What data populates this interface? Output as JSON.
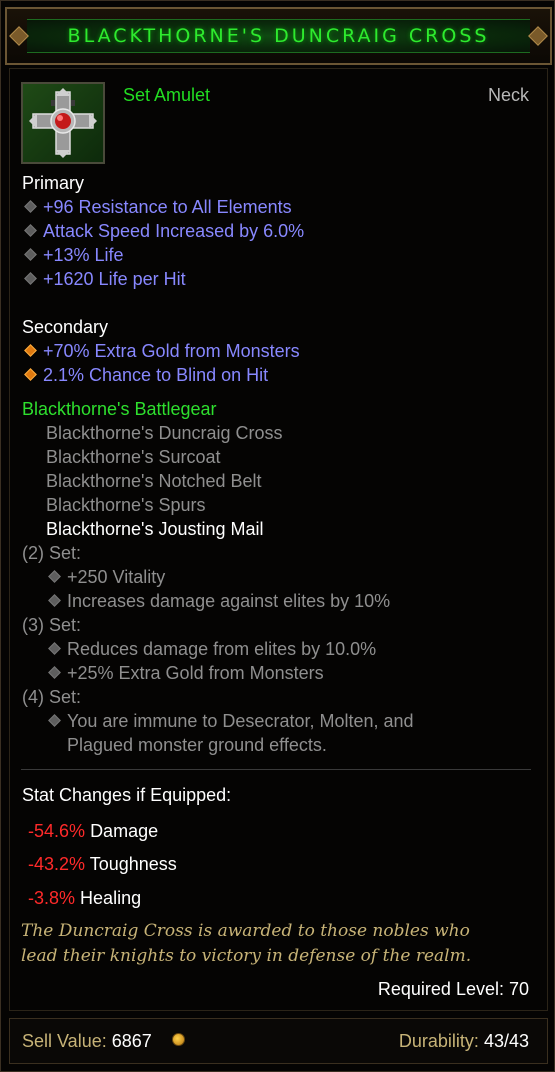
{
  "item": {
    "name": "BLACKTHORNE'S DUNCRAIG CROSS",
    "type": "Set Amulet",
    "slot": "Neck"
  },
  "primary": {
    "heading": "Primary",
    "stats": [
      "+96 Resistance to All Elements",
      "Attack Speed Increased by 6.0%",
      "+13% Life",
      "+1620 Life per Hit"
    ]
  },
  "secondary": {
    "heading": "Secondary",
    "stats": [
      "+70% Extra Gold from Monsters",
      "2.1% Chance to Blind on Hit"
    ]
  },
  "set": {
    "name": "Blackthorne's Battlegear",
    "pieces": [
      "Blackthorne's Duncraig Cross",
      "Blackthorne's Surcoat",
      "Blackthorne's Notched Belt",
      "Blackthorne's Spurs",
      "Blackthorne's Jousting Mail"
    ],
    "bonuses": [
      {
        "label": "(2) Set:",
        "effects": [
          "+250 Vitality",
          "Increases damage against elites by 10%"
        ]
      },
      {
        "label": "(3) Set:",
        "effects": [
          "Reduces damage from elites by 10.0%",
          "+25% Extra Gold from Monsters"
        ]
      },
      {
        "label": "(4) Set:",
        "effects": [
          "You are immune to Desecrator, Molten, and",
          "Plagued monster ground effects."
        ]
      }
    ]
  },
  "stat_changes": {
    "heading": "Stat Changes if Equipped:",
    "rows": [
      {
        "value": "-54.6%",
        "label": "Damage"
      },
      {
        "value": "-43.2%",
        "label": "Toughness"
      },
      {
        "value": "-3.8%",
        "label": "Healing"
      }
    ]
  },
  "flavor": {
    "line1": "The Duncraig Cross is awarded to those nobles who",
    "line2": "lead their knights to victory in defense of the realm."
  },
  "required_level": "Required Level: 70",
  "footer": {
    "sell_label": "Sell Value:",
    "sell_value": "6867",
    "durability_label": "Durability:",
    "durability_value": "43/43"
  },
  "colors": {
    "title_green": "#2eea2e",
    "set_green": "#2edf2e",
    "magic_blue": "#8888ff",
    "negative_red": "#ff2a2a",
    "flavor_gold": "#c7b377",
    "inactive_grey": "#8f8f8f"
  },
  "icons": {
    "item": "amulet-cross-icon",
    "coin": "gold-coin-icon",
    "bullet": "diamond-bullet-icon"
  }
}
